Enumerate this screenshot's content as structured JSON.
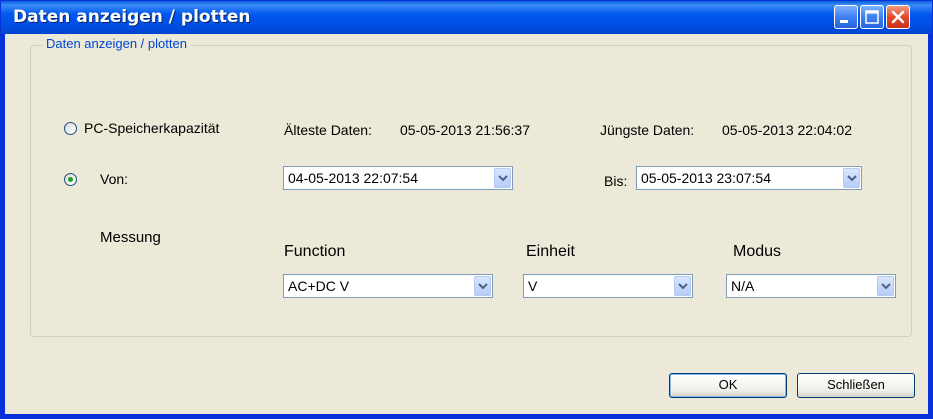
{
  "window": {
    "title": "Daten anzeigen / plotten"
  },
  "group": {
    "legend": "Daten anzeigen / plotten"
  },
  "range": {
    "pc_option_label": "PC-Speicherkapazität",
    "oldest_label": "Älteste Daten:",
    "oldest_value": "05-05-2013 21:56:37",
    "newest_label": "Jüngste Daten:",
    "newest_value": "05-05-2013 22:04:02",
    "from_option_label": "Von:",
    "from_value": "04-05-2013 22:07:54",
    "to_label": "Bis:",
    "to_value": "05-05-2013 23:07:54",
    "selected": "from"
  },
  "measurement": {
    "label": "Messung",
    "function_label": "Function",
    "function_value": "AC+DC V",
    "unit_label": "Einheit",
    "unit_value": "V",
    "mode_label": "Modus",
    "mode_value": "N/A"
  },
  "buttons": {
    "ok": "OK",
    "close": "Schließen"
  }
}
